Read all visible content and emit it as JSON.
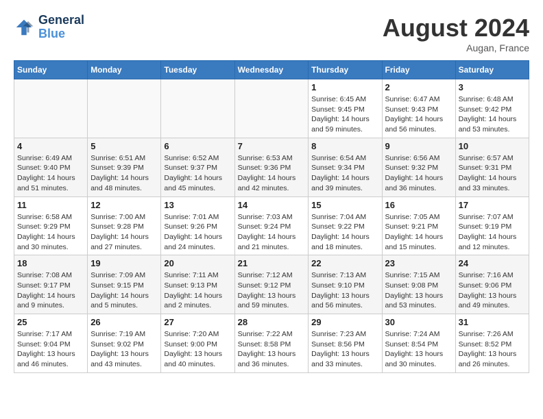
{
  "header": {
    "logo_line1": "General",
    "logo_line2": "Blue",
    "month_year": "August 2024",
    "location": "Augan, France"
  },
  "weekdays": [
    "Sunday",
    "Monday",
    "Tuesday",
    "Wednesday",
    "Thursday",
    "Friday",
    "Saturday"
  ],
  "weeks": [
    [
      {
        "day": "",
        "info": ""
      },
      {
        "day": "",
        "info": ""
      },
      {
        "day": "",
        "info": ""
      },
      {
        "day": "",
        "info": ""
      },
      {
        "day": "1",
        "info": "Sunrise: 6:45 AM\nSunset: 9:45 PM\nDaylight: 14 hours and 59 minutes."
      },
      {
        "day": "2",
        "info": "Sunrise: 6:47 AM\nSunset: 9:43 PM\nDaylight: 14 hours and 56 minutes."
      },
      {
        "day": "3",
        "info": "Sunrise: 6:48 AM\nSunset: 9:42 PM\nDaylight: 14 hours and 53 minutes."
      }
    ],
    [
      {
        "day": "4",
        "info": "Sunrise: 6:49 AM\nSunset: 9:40 PM\nDaylight: 14 hours and 51 minutes."
      },
      {
        "day": "5",
        "info": "Sunrise: 6:51 AM\nSunset: 9:39 PM\nDaylight: 14 hours and 48 minutes."
      },
      {
        "day": "6",
        "info": "Sunrise: 6:52 AM\nSunset: 9:37 PM\nDaylight: 14 hours and 45 minutes."
      },
      {
        "day": "7",
        "info": "Sunrise: 6:53 AM\nSunset: 9:36 PM\nDaylight: 14 hours and 42 minutes."
      },
      {
        "day": "8",
        "info": "Sunrise: 6:54 AM\nSunset: 9:34 PM\nDaylight: 14 hours and 39 minutes."
      },
      {
        "day": "9",
        "info": "Sunrise: 6:56 AM\nSunset: 9:32 PM\nDaylight: 14 hours and 36 minutes."
      },
      {
        "day": "10",
        "info": "Sunrise: 6:57 AM\nSunset: 9:31 PM\nDaylight: 14 hours and 33 minutes."
      }
    ],
    [
      {
        "day": "11",
        "info": "Sunrise: 6:58 AM\nSunset: 9:29 PM\nDaylight: 14 hours and 30 minutes."
      },
      {
        "day": "12",
        "info": "Sunrise: 7:00 AM\nSunset: 9:28 PM\nDaylight: 14 hours and 27 minutes."
      },
      {
        "day": "13",
        "info": "Sunrise: 7:01 AM\nSunset: 9:26 PM\nDaylight: 14 hours and 24 minutes."
      },
      {
        "day": "14",
        "info": "Sunrise: 7:03 AM\nSunset: 9:24 PM\nDaylight: 14 hours and 21 minutes."
      },
      {
        "day": "15",
        "info": "Sunrise: 7:04 AM\nSunset: 9:22 PM\nDaylight: 14 hours and 18 minutes."
      },
      {
        "day": "16",
        "info": "Sunrise: 7:05 AM\nSunset: 9:21 PM\nDaylight: 14 hours and 15 minutes."
      },
      {
        "day": "17",
        "info": "Sunrise: 7:07 AM\nSunset: 9:19 PM\nDaylight: 14 hours and 12 minutes."
      }
    ],
    [
      {
        "day": "18",
        "info": "Sunrise: 7:08 AM\nSunset: 9:17 PM\nDaylight: 14 hours and 9 minutes."
      },
      {
        "day": "19",
        "info": "Sunrise: 7:09 AM\nSunset: 9:15 PM\nDaylight: 14 hours and 5 minutes."
      },
      {
        "day": "20",
        "info": "Sunrise: 7:11 AM\nSunset: 9:13 PM\nDaylight: 14 hours and 2 minutes."
      },
      {
        "day": "21",
        "info": "Sunrise: 7:12 AM\nSunset: 9:12 PM\nDaylight: 13 hours and 59 minutes."
      },
      {
        "day": "22",
        "info": "Sunrise: 7:13 AM\nSunset: 9:10 PM\nDaylight: 13 hours and 56 minutes."
      },
      {
        "day": "23",
        "info": "Sunrise: 7:15 AM\nSunset: 9:08 PM\nDaylight: 13 hours and 53 minutes."
      },
      {
        "day": "24",
        "info": "Sunrise: 7:16 AM\nSunset: 9:06 PM\nDaylight: 13 hours and 49 minutes."
      }
    ],
    [
      {
        "day": "25",
        "info": "Sunrise: 7:17 AM\nSunset: 9:04 PM\nDaylight: 13 hours and 46 minutes."
      },
      {
        "day": "26",
        "info": "Sunrise: 7:19 AM\nSunset: 9:02 PM\nDaylight: 13 hours and 43 minutes."
      },
      {
        "day": "27",
        "info": "Sunrise: 7:20 AM\nSunset: 9:00 PM\nDaylight: 13 hours and 40 minutes."
      },
      {
        "day": "28",
        "info": "Sunrise: 7:22 AM\nSunset: 8:58 PM\nDaylight: 13 hours and 36 minutes."
      },
      {
        "day": "29",
        "info": "Sunrise: 7:23 AM\nSunset: 8:56 PM\nDaylight: 13 hours and 33 minutes."
      },
      {
        "day": "30",
        "info": "Sunrise: 7:24 AM\nSunset: 8:54 PM\nDaylight: 13 hours and 30 minutes."
      },
      {
        "day": "31",
        "info": "Sunrise: 7:26 AM\nSunset: 8:52 PM\nDaylight: 13 hours and 26 minutes."
      }
    ]
  ]
}
